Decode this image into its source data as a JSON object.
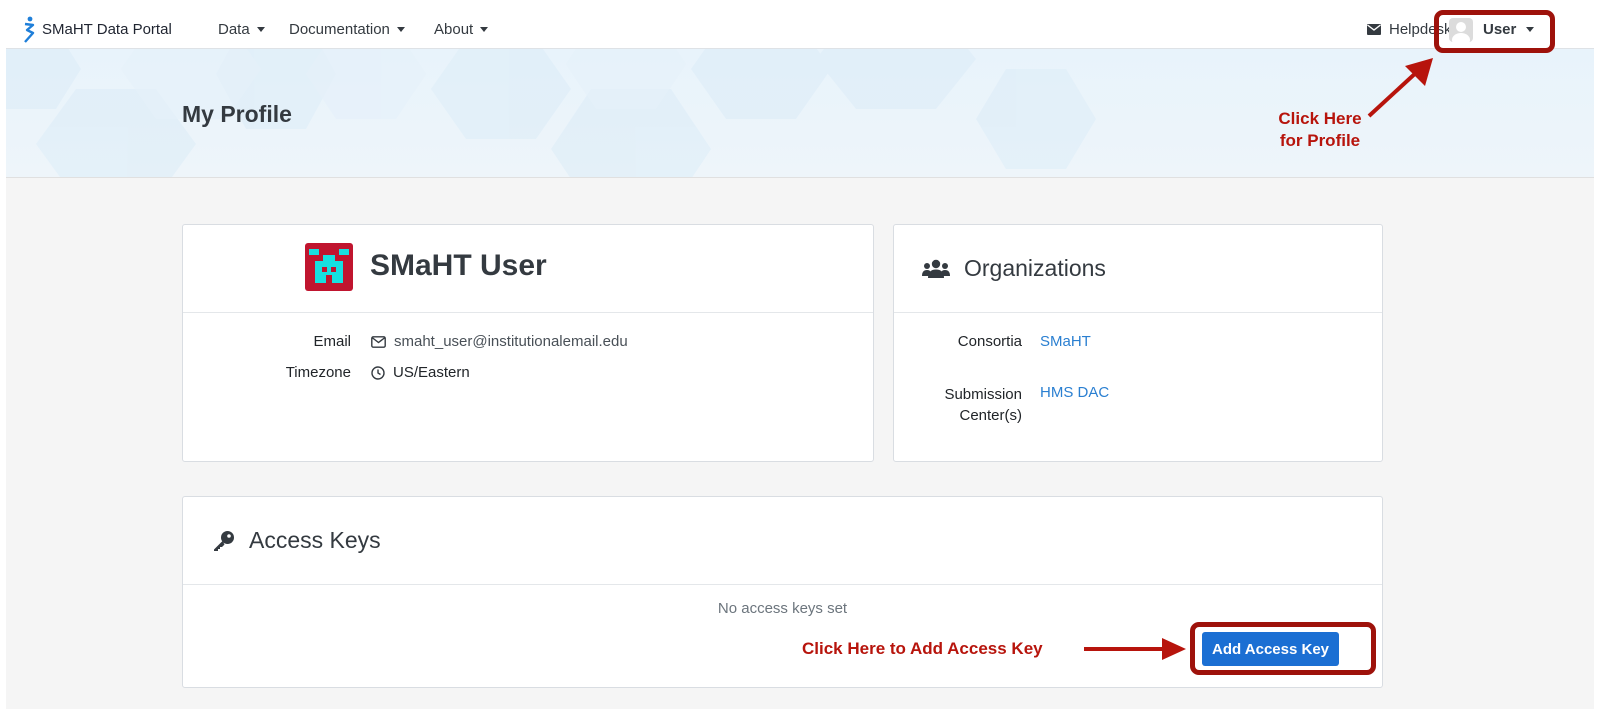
{
  "navbar": {
    "brand": "SMaHT Data Portal",
    "menus": [
      {
        "label": "Data"
      },
      {
        "label": "Documentation"
      },
      {
        "label": "About"
      }
    ],
    "helpdesk": "Helpdesk",
    "user": "User"
  },
  "hero": {
    "title": "My Profile"
  },
  "annotations": {
    "profile_line1": "Click Here",
    "profile_line2": "for Profile",
    "access_key": "Click Here to Add Access Key",
    "color": "#b7140c"
  },
  "profile": {
    "name": "SMaHT User",
    "email_label": "Email",
    "email": "smaht_user@institutionalemail.edu",
    "timezone_label": "Timezone",
    "timezone": "US/Eastern"
  },
  "organizations": {
    "title": "Organizations",
    "consortia_label": "Consortia",
    "consortia": "SMaHT",
    "submission_label_line1": "Submission",
    "submission_label_line2": "Center(s)",
    "submission_center": "HMS DAC"
  },
  "access_keys": {
    "title": "Access Keys",
    "empty": "No access keys set",
    "add_button": "Add Access Key"
  },
  "colors": {
    "primary": "#1b6fd3",
    "link": "#2a7fd1",
    "annotation": "#9e120b",
    "avatar_red": "#c0152f",
    "avatar_cyan": "#16e0e0"
  },
  "icons": [
    "smaht-logo-icon",
    "caret-down-icon",
    "envelope-icon",
    "user-avatar-icon",
    "profile-avatar-icon",
    "mail-outline-icon",
    "clock-icon",
    "users-icon",
    "key-icon",
    "arrow-icon"
  ]
}
